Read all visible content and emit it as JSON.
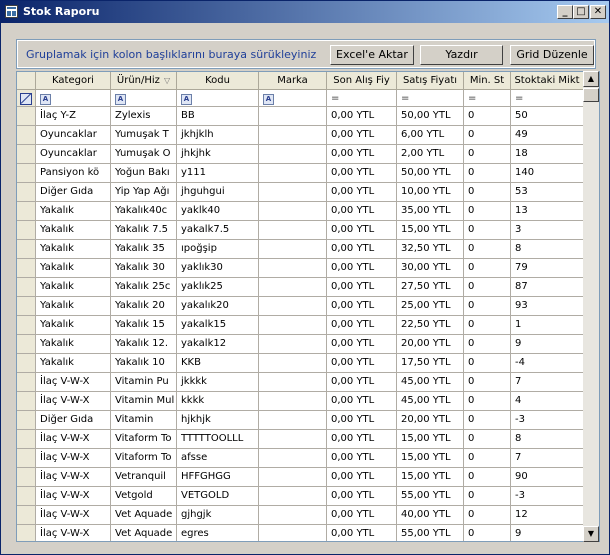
{
  "window": {
    "title": "Stok Raporu"
  },
  "titlebar_buttons": {
    "minimize": "_",
    "maximize": "□",
    "close": "✕"
  },
  "group_panel": {
    "hint": "Gruplamak için kolon başlıklarını buraya sürükleyiniz"
  },
  "actions": {
    "excel": "Excel'e Aktar",
    "print": "Yazdır",
    "grid_edit": "Grid Düzenle"
  },
  "columns": [
    "Kategori",
    "Ürün/Hiz",
    "Kodu",
    "Marka",
    "Son Alış Fiy",
    "Satış Fiyatı",
    "Min. St",
    "Stoktaki Mikt"
  ],
  "filter_ops": [
    "A",
    "A",
    "A",
    "A",
    "=",
    "=",
    "=",
    "="
  ],
  "rows": [
    [
      "İlaç Y-Z",
      "Zylexis",
      "BB",
      "",
      "0,00 YTL",
      "50,00 YTL",
      "0",
      "50"
    ],
    [
      "Oyuncaklar",
      "Yumuşak T",
      "jkhjklh",
      "",
      "0,00 YTL",
      "6,00 YTL",
      "0",
      "49"
    ],
    [
      "Oyuncaklar",
      "Yumuşak O",
      "jhkjhk",
      "",
      "0,00 YTL",
      "2,00 YTL",
      "0",
      "18"
    ],
    [
      "Pansiyon kö",
      "Yoğun Bakı",
      "y111",
      "",
      "0,00 YTL",
      "50,00 YTL",
      "0",
      "140"
    ],
    [
      "Diğer Gıda",
      "Yip Yap Ağı",
      "jhguhgui",
      "",
      "0,00 YTL",
      "10,00 YTL",
      "0",
      "53"
    ],
    [
      "Yakalık",
      "Yakalık40c",
      "yaklk40",
      "",
      "0,00 YTL",
      "35,00 YTL",
      "0",
      "13"
    ],
    [
      "Yakalık",
      "Yakalık 7.5",
      "yakalk7.5",
      "",
      "0,00 YTL",
      "15,00 YTL",
      "0",
      "3"
    ],
    [
      "Yakalık",
      "Yakalık 35",
      "ıpoğşip",
      "",
      "0,00 YTL",
      "32,50 YTL",
      "0",
      "8"
    ],
    [
      "Yakalık",
      "Yakalık 30",
      "yaklık30",
      "",
      "0,00 YTL",
      "30,00 YTL",
      "0",
      "79"
    ],
    [
      "Yakalık",
      "Yakalık 25c",
      "yaklık25",
      "",
      "0,00 YTL",
      "27,50 YTL",
      "0",
      "87"
    ],
    [
      "Yakalık",
      "Yakalık 20",
      "yakalık20",
      "",
      "0,00 YTL",
      "25,00 YTL",
      "0",
      "93"
    ],
    [
      "Yakalık",
      "Yakalık 15",
      "yakalk15",
      "",
      "0,00 YTL",
      "22,50 YTL",
      "0",
      "1"
    ],
    [
      "Yakalık",
      "Yakalık 12.",
      "yakalk12",
      "",
      "0,00 YTL",
      "20,00 YTL",
      "0",
      "9"
    ],
    [
      "Yakalık",
      "Yakalık 10",
      "KKB",
      "",
      "0,00 YTL",
      "17,50 YTL",
      "0",
      "-4"
    ],
    [
      "İlaç V-W-X",
      "Vitamin Pu",
      "jkkkk",
      "",
      "0,00 YTL",
      "45,00 YTL",
      "0",
      "7"
    ],
    [
      "İlaç V-W-X",
      "Vitamin Mul",
      "kkkk",
      "",
      "0,00 YTL",
      "45,00 YTL",
      "0",
      "4"
    ],
    [
      "Diğer Gıda",
      "Vitamin",
      "hjkhjk",
      "",
      "0,00 YTL",
      "20,00 YTL",
      "0",
      "-3"
    ],
    [
      "İlaç V-W-X",
      "Vitaform To",
      "TTTTTOOLLL",
      "",
      "0,00 YTL",
      "15,00 YTL",
      "0",
      "8"
    ],
    [
      "İlaç V-W-X",
      "Vitaform To",
      "afsse",
      "",
      "0,00 YTL",
      "15,00 YTL",
      "0",
      "7"
    ],
    [
      "İlaç V-W-X",
      "Vetranquil",
      "HFFGHGG",
      "",
      "0,00 YTL",
      "15,00 YTL",
      "0",
      "90"
    ],
    [
      "İlaç V-W-X",
      "Vetgold",
      "VETGOLD",
      "",
      "0,00 YTL",
      "55,00 YTL",
      "0",
      "-3"
    ],
    [
      "İlaç V-W-X",
      "Vet Aquade",
      "gjhgjk",
      "",
      "0,00 YTL",
      "40,00 YTL",
      "0",
      "12"
    ],
    [
      "İlaç V-W-X",
      "Vet Aquade",
      "egres",
      "",
      "0,00 YTL",
      "55,00 YTL",
      "0",
      "9"
    ]
  ]
}
